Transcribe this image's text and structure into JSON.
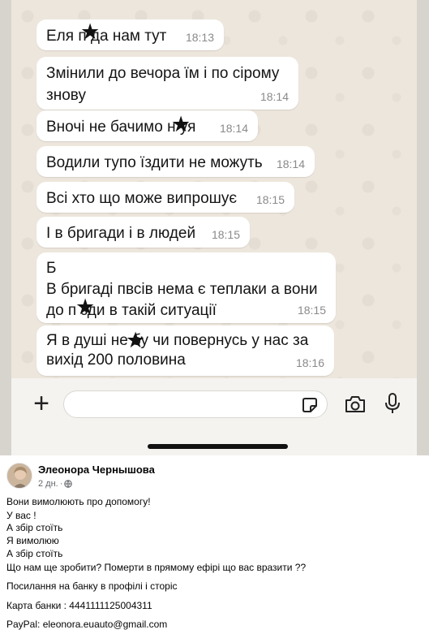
{
  "chat": {
    "messages": [
      {
        "text": "Еля п   да нам тут",
        "time": "18:13"
      },
      {
        "text": "Змінили до вечора їм і по сірому\nзнову",
        "time": "18:14"
      },
      {
        "text": "Вночі не бачимо н   уя",
        "time": "18:14"
      },
      {
        "text": "Водили тупо їздити не можуть",
        "time": "18:14"
      },
      {
        "text": "Всі хто що може випрошує",
        "time": "18:15"
      },
      {
        "text": "І в бригади і в людей",
        "time": "18:15"
      },
      {
        "text": "Б\nВ бригаді пвсів нема є теплаки а вони\nдо п    зди в такій ситуації",
        "time": "18:15"
      },
      {
        "text": "Я в душі не   бу чи повернусь у нас за\nвихід 200 половина",
        "time": "18:16"
      }
    ]
  },
  "composer": {
    "input_placeholder": "",
    "icons": [
      "plus-icon",
      "sticker-icon",
      "camera-icon",
      "microphone-icon"
    ]
  },
  "post": {
    "author": "Элеонора Чернышова",
    "time": "2 дн.",
    "privacy_icon": "globe-icon",
    "lines": [
      "Вони вимолюють про допомогу!",
      "У вас !",
      "А збір стоїть",
      "Я вимолюю",
      "А збір стоїть",
      "Що нам ще зробити? Померти в прямому ефірі що вас вразити ??",
      "Посилання на банку в профілі і сторіс",
      "Карта банки : 4441111125004311",
      "PayPal: eleonora.euauto@gmail.com"
    ]
  },
  "colors": {
    "chat_background": "#ede6dc",
    "bubble": "#ffffff",
    "timestamp": "#8a8a8a",
    "post_text": "#050505",
    "post_meta": "#65676b"
  }
}
